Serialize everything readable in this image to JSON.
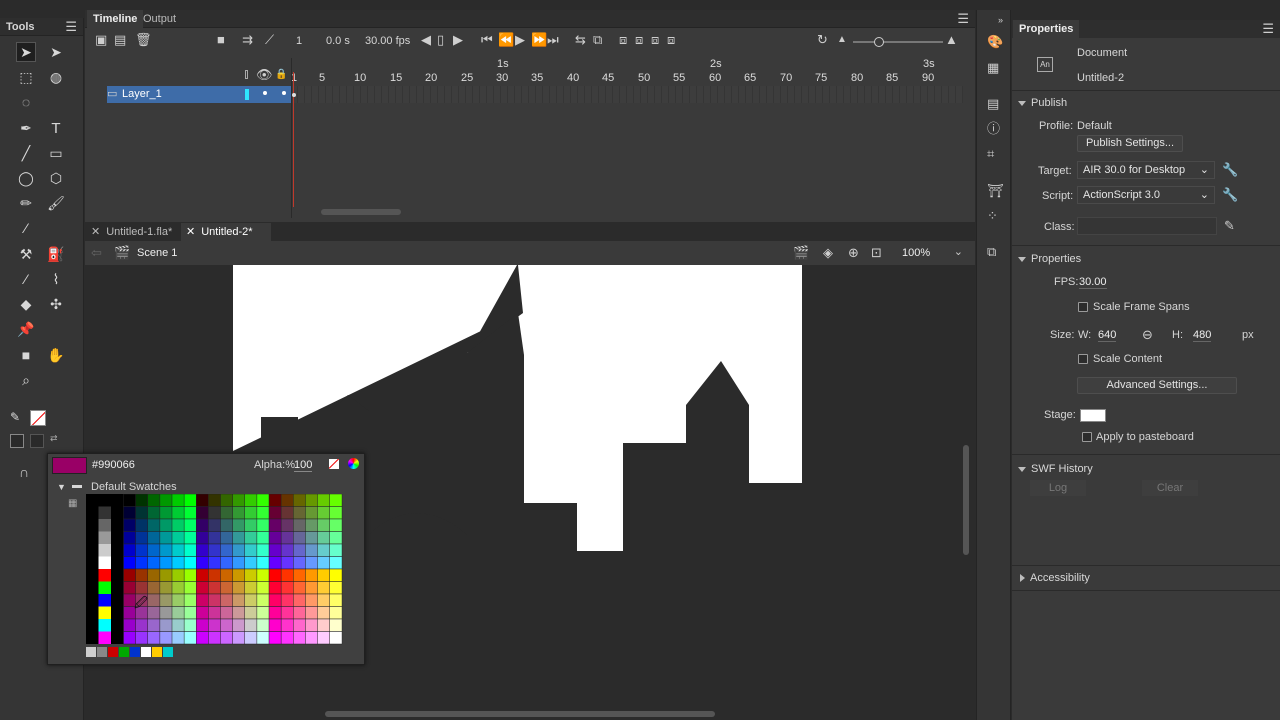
{
  "tools_panel": {
    "title": "Tools",
    "icons": [
      "selection-arrow-icon",
      "subselection-arrow-icon",
      "free-transform-icon",
      "3d-rotation-icon",
      "lasso-icon",
      "pen-icon",
      "text-icon",
      "line-icon",
      "rectangle-icon",
      "oval-icon",
      "polystar-icon",
      "pencil-icon",
      "paint-brush-icon",
      "brush-icon",
      "bone-icon",
      "paint-bucket-icon",
      "eyedropper-icon",
      "width-icon",
      "eraser-icon",
      "asset-warp-icon",
      "pin-icon",
      "camera-icon",
      "hand-icon",
      "zoom-icon",
      "stroke-color-icon",
      "fill-color-icon",
      "snap-magnet-icon"
    ]
  },
  "timeline": {
    "tabs": [
      "Timeline",
      "Output"
    ],
    "frame_number": "1",
    "time": "0.0 s",
    "fps": "30.00 fps",
    "layer_name": "Layer_1",
    "ruler_seconds": [
      "1s",
      "2s",
      "3s"
    ],
    "ruler_frames": [
      "1",
      "5",
      "10",
      "15",
      "20",
      "25",
      "30",
      "35",
      "40",
      "45",
      "50",
      "55",
      "60",
      "65",
      "70",
      "75",
      "80",
      "85",
      "90"
    ]
  },
  "document_tabs": [
    "Untitled-1.fla*",
    "Untitled-2*"
  ],
  "stage_bar": {
    "scene": "Scene 1",
    "zoom": "100%"
  },
  "swatch_popup": {
    "hex": "#990066",
    "alpha_label": "Alpha:%",
    "alpha_value": "100",
    "folder": "Default Swatches",
    "current_color": "#990066"
  },
  "properties": {
    "tab": "Properties",
    "doc_type": "Document",
    "doc_name": "Untitled-2",
    "publish": {
      "header": "Publish",
      "profile_label": "Profile:",
      "profile_value": "Default",
      "settings_button": "Publish Settings...",
      "target_label": "Target:",
      "target_value": "AIR 30.0 for Desktop",
      "script_label": "Script:",
      "script_value": "ActionScript 3.0",
      "class_label": "Class:"
    },
    "props": {
      "header": "Properties",
      "fps_label": "FPS:",
      "fps_value": "30.00",
      "scale_spans": "Scale Frame Spans",
      "size_label": "Size:",
      "w_label": "W:",
      "w_value": "640",
      "h_label": "H:",
      "h_value": "480",
      "unit": "px",
      "scale_content": "Scale Content",
      "advanced_button": "Advanced Settings...",
      "stage_label": "Stage:",
      "stage_color": "#ffffff",
      "pasteboard": "Apply to pasteboard"
    },
    "swf_history": {
      "header": "SWF History",
      "log": "Log",
      "clear": "Clear"
    },
    "accessibility": "Accessibility"
  }
}
